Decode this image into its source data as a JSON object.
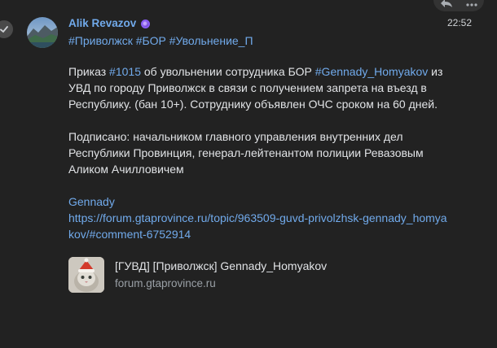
{
  "message": {
    "author": "Alik Revazov",
    "time": "22:52",
    "tags": [
      "#Приволжск",
      "#БОР",
      "#Увольнение_П"
    ],
    "order": {
      "prefix": "Приказ ",
      "number_tag": "#1015",
      "middle": " об увольнении сотрудника БОР ",
      "name_tag": "#Gennady_Homyakov",
      "rest": " из УВД по городу Приволжск в связи с получением запрета на въезд в Республику. (бан 10+). Сотруднику объявлен ОЧС сроком на 60 дней."
    },
    "signed": "Подписано: начальником главного управления внутренних дел Республики Провинция, генерал-лейтенантом полиции Ревазовым Аликом Ачилловичем",
    "link_label": "Gennady",
    "link_url": "https://forum.gtaprovince.ru/topic/963509-guvd-privolzhsk-gennady_homyakov/#comment-6752914",
    "preview": {
      "title": "[ГУВД] [Приволжск] Gennady_Homyakov",
      "domain": "forum.gtaprovince.ru"
    }
  },
  "icons": {
    "status": "check-icon",
    "badge": "premium-badge-icon",
    "toolbar": [
      "reply-icon",
      "more-icon"
    ]
  },
  "colors": {
    "background": "#222222",
    "link": "#71aaeb",
    "text": "#e1e3e6"
  }
}
